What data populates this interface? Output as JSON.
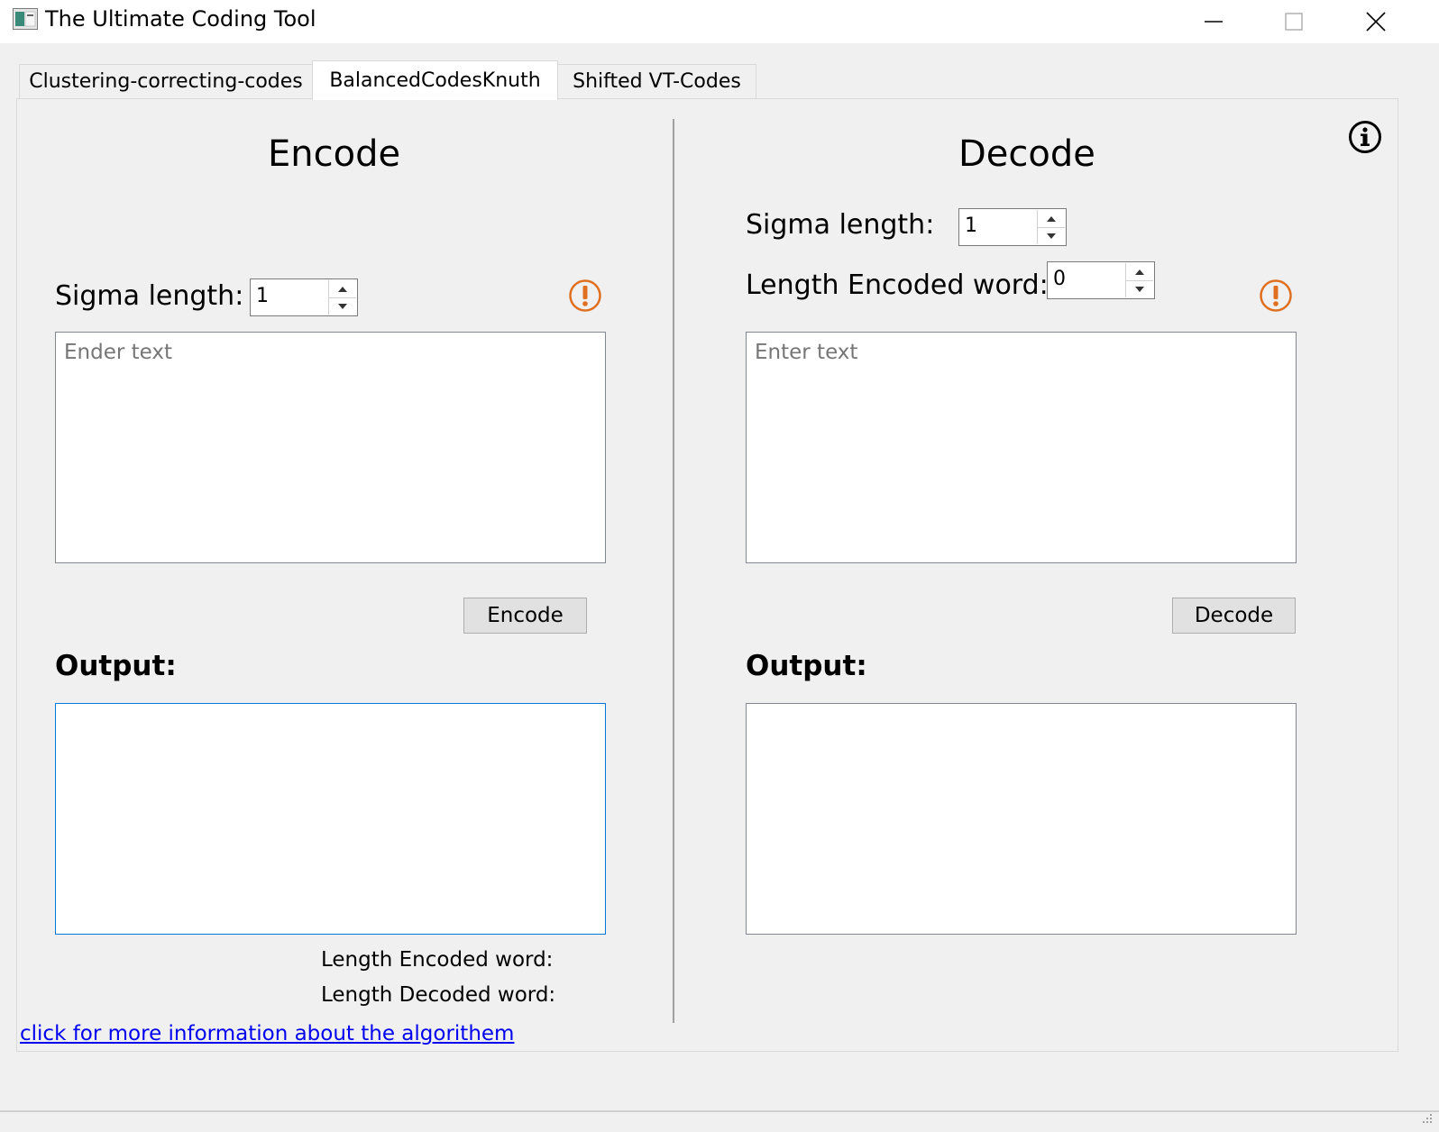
{
  "window": {
    "title": "The Ultimate Coding Tool"
  },
  "tabs": [
    {
      "label": "Clustering-correcting-codes",
      "active": false
    },
    {
      "label": "BalancedCodesKnuth",
      "active": true
    },
    {
      "label": "Shifted VT-Codes",
      "active": false
    }
  ],
  "encode": {
    "heading": "Encode",
    "sigma_label": "Sigma length:",
    "sigma_value": "1",
    "input_placeholder": "Ender text",
    "button_label": "Encode",
    "output_label": "Output:",
    "length_encoded_label": "Length Encoded word:",
    "length_decoded_label": "Length Decoded word:"
  },
  "decode": {
    "heading": "Decode",
    "sigma_label": "Sigma length:",
    "sigma_value": "1",
    "length_encoded_label": "Length Encoded word:",
    "length_encoded_value": "0",
    "input_placeholder": "Enter text",
    "button_label": "Decode",
    "output_label": "Output:"
  },
  "footer": {
    "link_text": "click for more information about the algorithem"
  },
  "icons": {
    "warning_color": "#e07020",
    "info_color": "#000000",
    "link_color": "#0000ee",
    "focus_color": "#0078d7"
  }
}
